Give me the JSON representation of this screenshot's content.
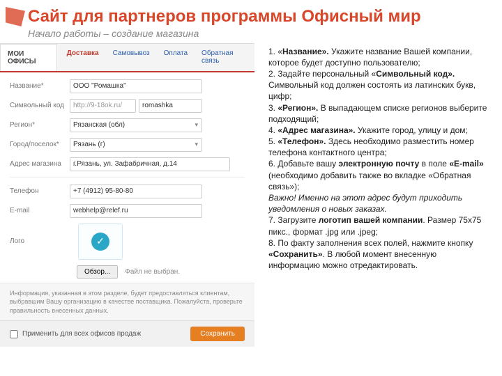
{
  "slide": {
    "title": "Сайт для партнеров программы Офисный мир",
    "subtitle": "Начало работы – создание магазина"
  },
  "ui": {
    "mainTab": "МОИ ОФИСЫ",
    "tabs": [
      "Доставка",
      "Самовывоз",
      "Оплата",
      "Обратная связь"
    ],
    "activeTab": 0,
    "fields": {
      "name_label": "Название*",
      "name_value": "ООО \"Ромашка\"",
      "code_label": "Символьный код",
      "url_prefix": "http://9-18ok.ru/",
      "url_code": "romashka",
      "region_label": "Регион*",
      "region_value": "Рязанская (обл)",
      "city_label": "Город/поселок*",
      "city_value": "Рязань (г)",
      "address_label": "Адрес магазина",
      "address_value": "г.Рязань, ул. Зафабричная, д.14",
      "phone_label": "Телефон",
      "phone_value": "+7 (4912) 95-80-80",
      "email_label": "E-mail",
      "email_value": "webhelp@relef.ru",
      "logo_label": "Лого",
      "browse_label": "Обзор...",
      "no_file": "Файл не выбран.",
      "info_note": "Информация, указанная в этом разделе, будет предоставляться клиентам, выбравшим Вашу организацию в качестве поставщика. Пожалуйста, проверьте правильность внесенных данных.",
      "apply_all_label": "Применить для всех офисов продаж",
      "save_label": "Сохранить"
    }
  },
  "instructions": {
    "p1a": "1. «",
    "p1b": "Название».",
    "p1c": " Укажите название Вашей компании, которое будет доступно пользователю;",
    "p2a": "2. ",
    "p2b": "Задайте персональный «",
    "p2c": "Символьный код».",
    "p2d": "Символьный код должен состоять из латинских букв, цифр;",
    "p3a": "3. ",
    "p3b": "«Регион».",
    "p3c": " В выпадающем списке регионов выберите подходящий;",
    "p4a": "4. ",
    "p4b": "«Адрес магазина».",
    "p4c": " Укажите город, улицу и дом;",
    "p5a": "5. ",
    "p5b": "«Телефон».",
    "p5c": " Здесь необходимо разместить номер телефона контактного центра;",
    "p6a": "6. ",
    "p6b": "Добавьте вашу ",
    "p6c": "электронную почту",
    "p6d": " в поле ",
    "p6e": "«E-mail»",
    "p6f": " (необходимо добавить также во вкладке «Обратная связь»);",
    "p6g": "Важно! Именно на этот адрес будут приходить уведомления о новых заказах.",
    "p7a": "7. ",
    "p7b": "Загрузите ",
    "p7c": "логотип вашей компании",
    "p7d": ". Размер 75х75 пикс., формат .jpg или .jpeg;",
    "p8a": "8. ",
    "p8b": "По факту заполнения всех полей, нажмите кнопку ",
    "p8c": "«Сохранить»",
    "p8d": ". В любой момент внесенную информацию можно отредактировать."
  }
}
